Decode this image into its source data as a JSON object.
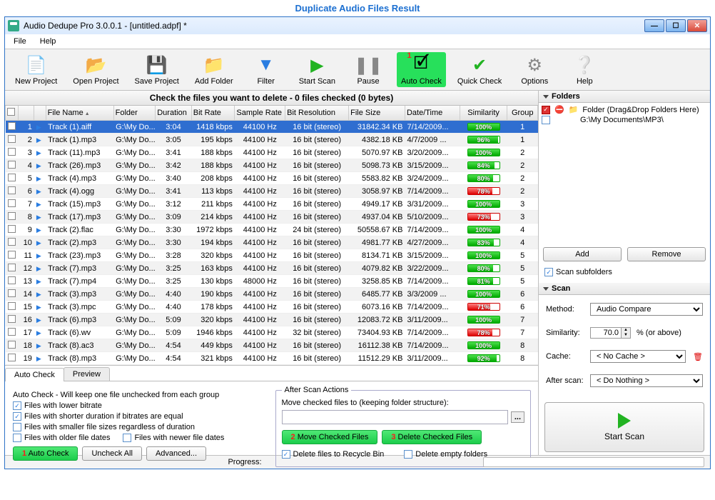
{
  "page_title": "Duplicate Audio Files Result",
  "window_title": "Audio Dedupe Pro 3.0.0.1 - [untitled.adpf] *",
  "menu": {
    "file": "File",
    "help": "Help"
  },
  "toolbar": {
    "new_project": "New Project",
    "open_project": "Open Project",
    "save_project": "Save Project",
    "add_folder": "Add Folder",
    "filter": "Filter",
    "start_scan": "Start Scan",
    "pause": "Pause",
    "auto_check": "Auto Check",
    "marker_auto": "1",
    "quick_check": "Quick Check",
    "options": "Options",
    "help": "Help"
  },
  "span_header": "Check the files you want to delete - 0 files checked (0 bytes)",
  "columns": {
    "check": "",
    "num": "",
    "play": "",
    "file_name": "File Name",
    "folder": "Folder",
    "duration": "Duration",
    "bitrate": "Bit Rate",
    "sample_rate": "Sample Rate",
    "bit_resolution": "Bit Resolution",
    "file_size": "File Size",
    "date_time": "Date/Time",
    "similarity": "Similarity",
    "group": "Group"
  },
  "rows": [
    {
      "n": "1",
      "name": "Track (1).aiff",
      "folder": "G:\\My Do...",
      "dur": "3:04",
      "br": "1418 kbps",
      "sr": "44100 Hz",
      "res": "16 bit (stereo)",
      "size": "31842.34 KB",
      "dt": "7/14/2009...",
      "sim": "100%",
      "sv": 100,
      "g": "1",
      "sel": true
    },
    {
      "n": "2",
      "name": "Track (1).mp3",
      "folder": "G:\\My Do...",
      "dur": "3:05",
      "br": "195 kbps",
      "sr": "44100 Hz",
      "res": "16 bit (stereo)",
      "size": "4382.18 KB",
      "dt": "4/7/2009 ...",
      "sim": "96%",
      "sv": 96,
      "g": "1"
    },
    {
      "n": "3",
      "name": "Track (11).mp3",
      "folder": "G:\\My Do...",
      "dur": "3:41",
      "br": "188 kbps",
      "sr": "44100 Hz",
      "res": "16 bit (stereo)",
      "size": "5070.97 KB",
      "dt": "3/20/2009...",
      "sim": "100%",
      "sv": 100,
      "g": "2"
    },
    {
      "n": "4",
      "name": "Track (26).mp3",
      "folder": "G:\\My Do...",
      "dur": "3:42",
      "br": "188 kbps",
      "sr": "44100 Hz",
      "res": "16 bit (stereo)",
      "size": "5098.73 KB",
      "dt": "3/15/2009...",
      "sim": "84%",
      "sv": 84,
      "g": "2"
    },
    {
      "n": "5",
      "name": "Track (4).mp3",
      "folder": "G:\\My Do...",
      "dur": "3:40",
      "br": "208 kbps",
      "sr": "44100 Hz",
      "res": "16 bit (stereo)",
      "size": "5583.82 KB",
      "dt": "3/24/2009...",
      "sim": "80%",
      "sv": 80,
      "g": "2"
    },
    {
      "n": "6",
      "name": "Track (4).ogg",
      "folder": "G:\\My Do...",
      "dur": "3:41",
      "br": "113 kbps",
      "sr": "44100 Hz",
      "res": "16 bit (stereo)",
      "size": "3058.97 KB",
      "dt": "7/14/2009...",
      "sim": "78%",
      "sv": 78,
      "red": true,
      "g": "2"
    },
    {
      "n": "7",
      "name": "Track (15).mp3",
      "folder": "G:\\My Do...",
      "dur": "3:12",
      "br": "211 kbps",
      "sr": "44100 Hz",
      "res": "16 bit (stereo)",
      "size": "4949.17 KB",
      "dt": "3/31/2009...",
      "sim": "100%",
      "sv": 100,
      "g": "3"
    },
    {
      "n": "8",
      "name": "Track (17).mp3",
      "folder": "G:\\My Do...",
      "dur": "3:09",
      "br": "214 kbps",
      "sr": "44100 Hz",
      "res": "16 bit (stereo)",
      "size": "4937.04 KB",
      "dt": "5/10/2009...",
      "sim": "73%",
      "sv": 73,
      "red": true,
      "g": "3"
    },
    {
      "n": "9",
      "name": "Track (2).flac",
      "folder": "G:\\My Do...",
      "dur": "3:30",
      "br": "1972 kbps",
      "sr": "44100 Hz",
      "res": "24 bit (stereo)",
      "size": "50558.67 KB",
      "dt": "7/14/2009...",
      "sim": "100%",
      "sv": 100,
      "g": "4"
    },
    {
      "n": "10",
      "name": "Track (2).mp3",
      "folder": "G:\\My Do...",
      "dur": "3:30",
      "br": "194 kbps",
      "sr": "44100 Hz",
      "res": "16 bit (stereo)",
      "size": "4981.77 KB",
      "dt": "4/27/2009...",
      "sim": "83%",
      "sv": 83,
      "g": "4"
    },
    {
      "n": "11",
      "name": "Track (23).mp3",
      "folder": "G:\\My Do...",
      "dur": "3:28",
      "br": "320 kbps",
      "sr": "44100 Hz",
      "res": "16 bit (stereo)",
      "size": "8134.71 KB",
      "dt": "3/15/2009...",
      "sim": "100%",
      "sv": 100,
      "g": "5"
    },
    {
      "n": "12",
      "name": "Track (7).mp3",
      "folder": "G:\\My Do...",
      "dur": "3:25",
      "br": "163 kbps",
      "sr": "44100 Hz",
      "res": "16 bit (stereo)",
      "size": "4079.82 KB",
      "dt": "3/22/2009...",
      "sim": "80%",
      "sv": 80,
      "g": "5"
    },
    {
      "n": "13",
      "name": "Track (7).mp4",
      "folder": "G:\\My Do...",
      "dur": "3:25",
      "br": "130 kbps",
      "sr": "48000 Hz",
      "res": "16 bit (stereo)",
      "size": "3258.85 KB",
      "dt": "7/14/2009...",
      "sim": "81%",
      "sv": 81,
      "g": "5"
    },
    {
      "n": "14",
      "name": "Track (3).mp3",
      "folder": "G:\\My Do...",
      "dur": "4:40",
      "br": "190 kbps",
      "sr": "44100 Hz",
      "res": "16 bit (stereo)",
      "size": "6485.77 KB",
      "dt": "3/3/2009 ...",
      "sim": "100%",
      "sv": 100,
      "g": "6"
    },
    {
      "n": "15",
      "name": "Track (3).mpc",
      "folder": "G:\\My Do...",
      "dur": "4:40",
      "br": "178 kbps",
      "sr": "44100 Hz",
      "res": "16 bit (stereo)",
      "size": "6073.16 KB",
      "dt": "7/14/2009...",
      "sim": "71%",
      "sv": 71,
      "red": true,
      "g": "6"
    },
    {
      "n": "16",
      "name": "Track (6).mp3",
      "folder": "G:\\My Do...",
      "dur": "5:09",
      "br": "320 kbps",
      "sr": "44100 Hz",
      "res": "16 bit (stereo)",
      "size": "12083.72 KB",
      "dt": "3/11/2009...",
      "sim": "100%",
      "sv": 100,
      "g": "7"
    },
    {
      "n": "17",
      "name": "Track (6).wv",
      "folder": "G:\\My Do...",
      "dur": "5:09",
      "br": "1946 kbps",
      "sr": "44100 Hz",
      "res": "32 bit (stereo)",
      "size": "73404.93 KB",
      "dt": "7/14/2009...",
      "sim": "78%",
      "sv": 78,
      "red": true,
      "g": "7"
    },
    {
      "n": "18",
      "name": "Track (8).ac3",
      "folder": "G:\\My Do...",
      "dur": "4:54",
      "br": "449 kbps",
      "sr": "44100 Hz",
      "res": "16 bit (stereo)",
      "size": "16112.38 KB",
      "dt": "7/14/2009...",
      "sim": "100%",
      "sv": 100,
      "g": "8"
    },
    {
      "n": "19",
      "name": "Track (8).mp3",
      "folder": "G:\\My Do...",
      "dur": "4:54",
      "br": "321 kbps",
      "sr": "44100 Hz",
      "res": "16 bit (stereo)",
      "size": "11512.29 KB",
      "dt": "3/11/2009...",
      "sim": "92%",
      "sv": 92,
      "g": "8"
    }
  ],
  "folders": {
    "header": "Folders",
    "items": [
      {
        "label": "Folder (Drag&Drop Folders Here)",
        "selected": true,
        "prohibit": true,
        "icon": true
      },
      {
        "label": "G:\\My Documents\\MP3\\",
        "selected": false,
        "prohibit": false
      }
    ],
    "add_btn": "Add",
    "remove_btn": "Remove",
    "scan_sub": "Scan subfolders"
  },
  "scan": {
    "header": "Scan",
    "method_lbl": "Method:",
    "method_val": "Audio Compare",
    "sim_lbl": "Similarity:",
    "sim_val": "70.0",
    "sim_suf": "% (or above)",
    "cache_lbl": "Cache:",
    "cache_val": "< No Cache >",
    "after_lbl": "After scan:",
    "after_val": "< Do Nothing >",
    "start_btn": "Start Scan"
  },
  "tabs": {
    "auto_check": "Auto Check",
    "preview": "Preview"
  },
  "autocheck": {
    "desc": "Auto Check - Will keep one file unchecked from each group",
    "opt_bitrate": "Files with lower bitrate",
    "opt_duration": "Files with shorter duration if bitrates are equal",
    "opt_size": "Files with smaller file sizes regardless of duration",
    "opt_older": "Files with older file dates",
    "opt_newer": "Files with newer file dates",
    "btn_auto": "Auto Check",
    "marker_auto": "1",
    "btn_uncheck": "Uncheck All",
    "btn_adv": "Advanced..."
  },
  "after_actions": {
    "legend": "After Scan Actions",
    "move_lbl": "Move checked files to (keeping folder structure):",
    "move_btn": "Move Checked Files",
    "marker_move": "2",
    "del_btn": "Delete Checked Files",
    "marker_del": "3",
    "recycle": "Delete files to Recycle Bin",
    "empty": "Delete empty folders"
  },
  "status": {
    "progress_lbl": "Progress:"
  }
}
